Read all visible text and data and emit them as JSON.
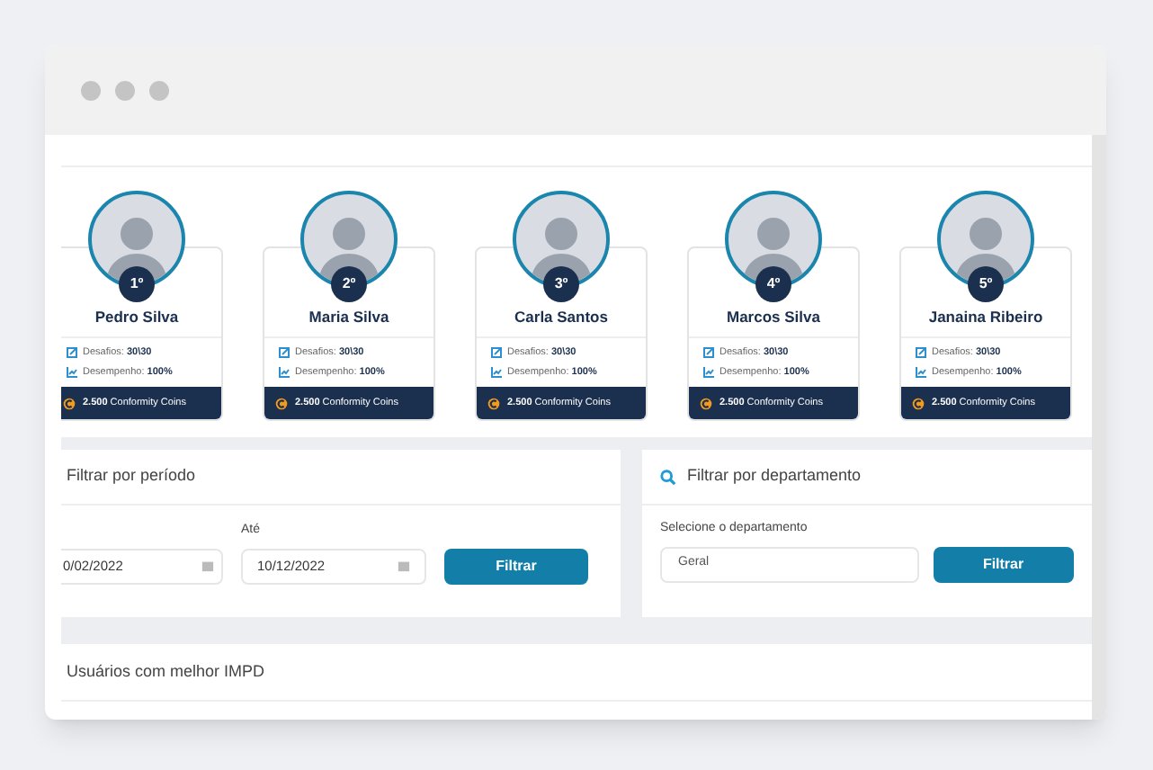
{
  "ranking": [
    {
      "rank": "1º",
      "name": "Pedro Silva",
      "challenges_label": "Desafios:",
      "challenges": "30\\30",
      "performance_label": "Desempenho:",
      "performance": "100%",
      "coins": "2.500",
      "coins_label": "Conformity Coins"
    },
    {
      "rank": "2º",
      "name": "Maria Silva",
      "challenges_label": "Desafios:",
      "challenges": "30\\30",
      "performance_label": "Desempenho:",
      "performance": "100%",
      "coins": "2.500",
      "coins_label": "Conformity Coins"
    },
    {
      "rank": "3º",
      "name": "Carla Santos",
      "challenges_label": "Desafios:",
      "challenges": "30\\30",
      "performance_label": "Desempenho:",
      "performance": "100%",
      "coins": "2.500",
      "coins_label": "Conformity Coins"
    },
    {
      "rank": "4º",
      "name": "Marcos Silva",
      "challenges_label": "Desafios:",
      "challenges": "30\\30",
      "performance_label": "Desempenho:",
      "performance": "100%",
      "coins": "2.500",
      "coins_label": "Conformity Coins"
    },
    {
      "rank": "5º",
      "name": "Janaina Ribeiro",
      "challenges_label": "Desafios:",
      "challenges": "30\\30",
      "performance_label": "Desempenho:",
      "performance": "100%",
      "coins": "2.500",
      "coins_label": "Conformity Coins"
    }
  ],
  "period_filter": {
    "title": "Filtrar por período",
    "from_value": "0/02/2022",
    "to_label": "Até",
    "to_value": "10/12/2022",
    "button": "Filtrar"
  },
  "department_filter": {
    "title": "Filtrar por departamento",
    "label": "Selecione o departamento",
    "value": "Geral",
    "button": "Filtrar"
  },
  "best_users": {
    "title": "Usuários com melhor IMPD"
  }
}
